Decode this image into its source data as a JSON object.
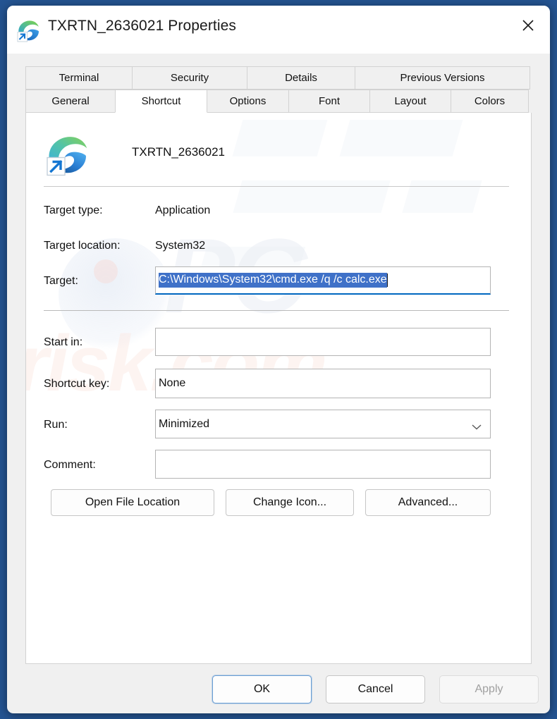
{
  "window": {
    "title": "TXRTN_2636021 Properties",
    "icon": "edge-shortcut-icon",
    "close_label": "×"
  },
  "tabs": {
    "row1": [
      {
        "label": "Terminal",
        "selected": false
      },
      {
        "label": "Security",
        "selected": false
      },
      {
        "label": "Details",
        "selected": false
      },
      {
        "label": "Previous Versions",
        "selected": false
      }
    ],
    "row2": [
      {
        "label": "General",
        "selected": false
      },
      {
        "label": "Shortcut",
        "selected": true
      },
      {
        "label": "Options",
        "selected": false
      },
      {
        "label": "Font",
        "selected": false
      },
      {
        "label": "Layout",
        "selected": false
      },
      {
        "label": "Colors",
        "selected": false
      }
    ]
  },
  "shortcut_tab": {
    "header": {
      "name": "TXRTN_2636021",
      "icon": "edge-shortcut-icon"
    },
    "rows": {
      "target_type_label": "Target type:",
      "target_type_value": "Application",
      "target_location_label": "Target location:",
      "target_location_value": "System32",
      "target_label": "Target:",
      "target_value": "C:\\Windows\\System32\\cmd.exe /q /c calc.exe",
      "start_in_label": "Start in:",
      "start_in_value": "",
      "shortcut_key_label": "Shortcut key:",
      "shortcut_key_value": "None",
      "run_label": "Run:",
      "run_value": "Minimized",
      "comment_label": "Comment:",
      "comment_value": ""
    },
    "buttons": {
      "open_file_location": "Open File Location",
      "change_icon": "Change Icon...",
      "advanced": "Advanced..."
    }
  },
  "footer": {
    "ok": "OK",
    "cancel": "Cancel",
    "apply": "Apply"
  },
  "watermark": {
    "primary": "PC",
    "secondary": "risk.com"
  },
  "colors": {
    "backdrop_blue": "#245492",
    "selection_blue": "#3f71c8",
    "focus_underline": "#0067c0",
    "default_button_border": "#6b9fd4",
    "panel_white": "#ffffff",
    "dialog_gray": "#f0f0f0"
  }
}
